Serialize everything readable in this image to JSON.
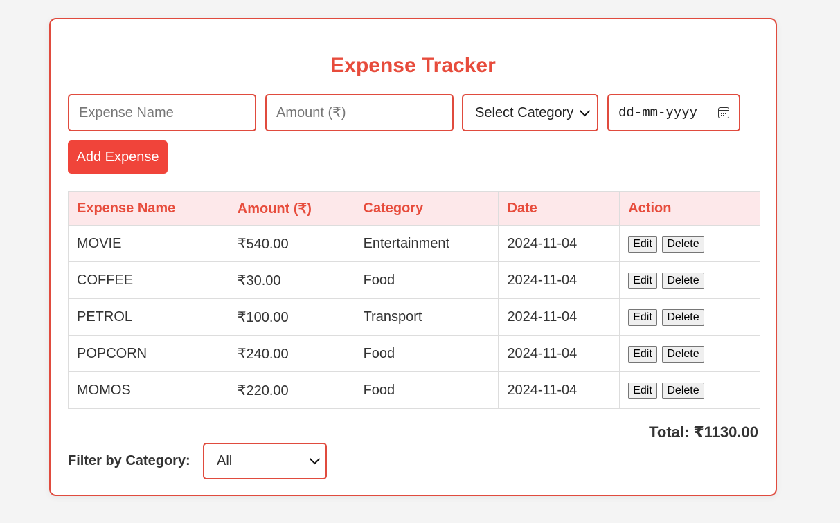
{
  "app": {
    "title": "Expense Tracker"
  },
  "form": {
    "name_placeholder": "Expense Name",
    "name_value": "",
    "amount_placeholder": "Amount (₹)",
    "amount_value": "",
    "category_selected": "Select Category",
    "date_placeholder": "dd-mm-yyyy",
    "add_label": "Add Expense"
  },
  "table": {
    "headers": [
      "Expense Name",
      "Amount (₹)",
      "Category",
      "Date",
      "Action"
    ],
    "rows": [
      {
        "name": "MOVIE",
        "amount": "₹540.00",
        "category": "Entertainment",
        "date": "2024-11-04"
      },
      {
        "name": "COFFEE",
        "amount": "₹30.00",
        "category": "Food",
        "date": "2024-11-04"
      },
      {
        "name": "PETROL",
        "amount": "₹100.00",
        "category": "Transport",
        "date": "2024-11-04"
      },
      {
        "name": "POPCORN",
        "amount": "₹240.00",
        "category": "Food",
        "date": "2024-11-04"
      },
      {
        "name": "MOMOS",
        "amount": "₹220.00",
        "category": "Food",
        "date": "2024-11-04"
      }
    ],
    "edit_label": "Edit",
    "delete_label": "Delete"
  },
  "summary": {
    "total_label": "Total: ₹1130.00"
  },
  "filter": {
    "label": "Filter by Category:",
    "selected": "All"
  },
  "icons": {
    "date_picker": "calendar-icon",
    "select_arrow": "chevron-down-icon"
  },
  "colors": {
    "accent": "#e74c3c",
    "button": "#f0443a",
    "header_bg": "#fde8ea",
    "page_bg": "#f4f4f4"
  }
}
